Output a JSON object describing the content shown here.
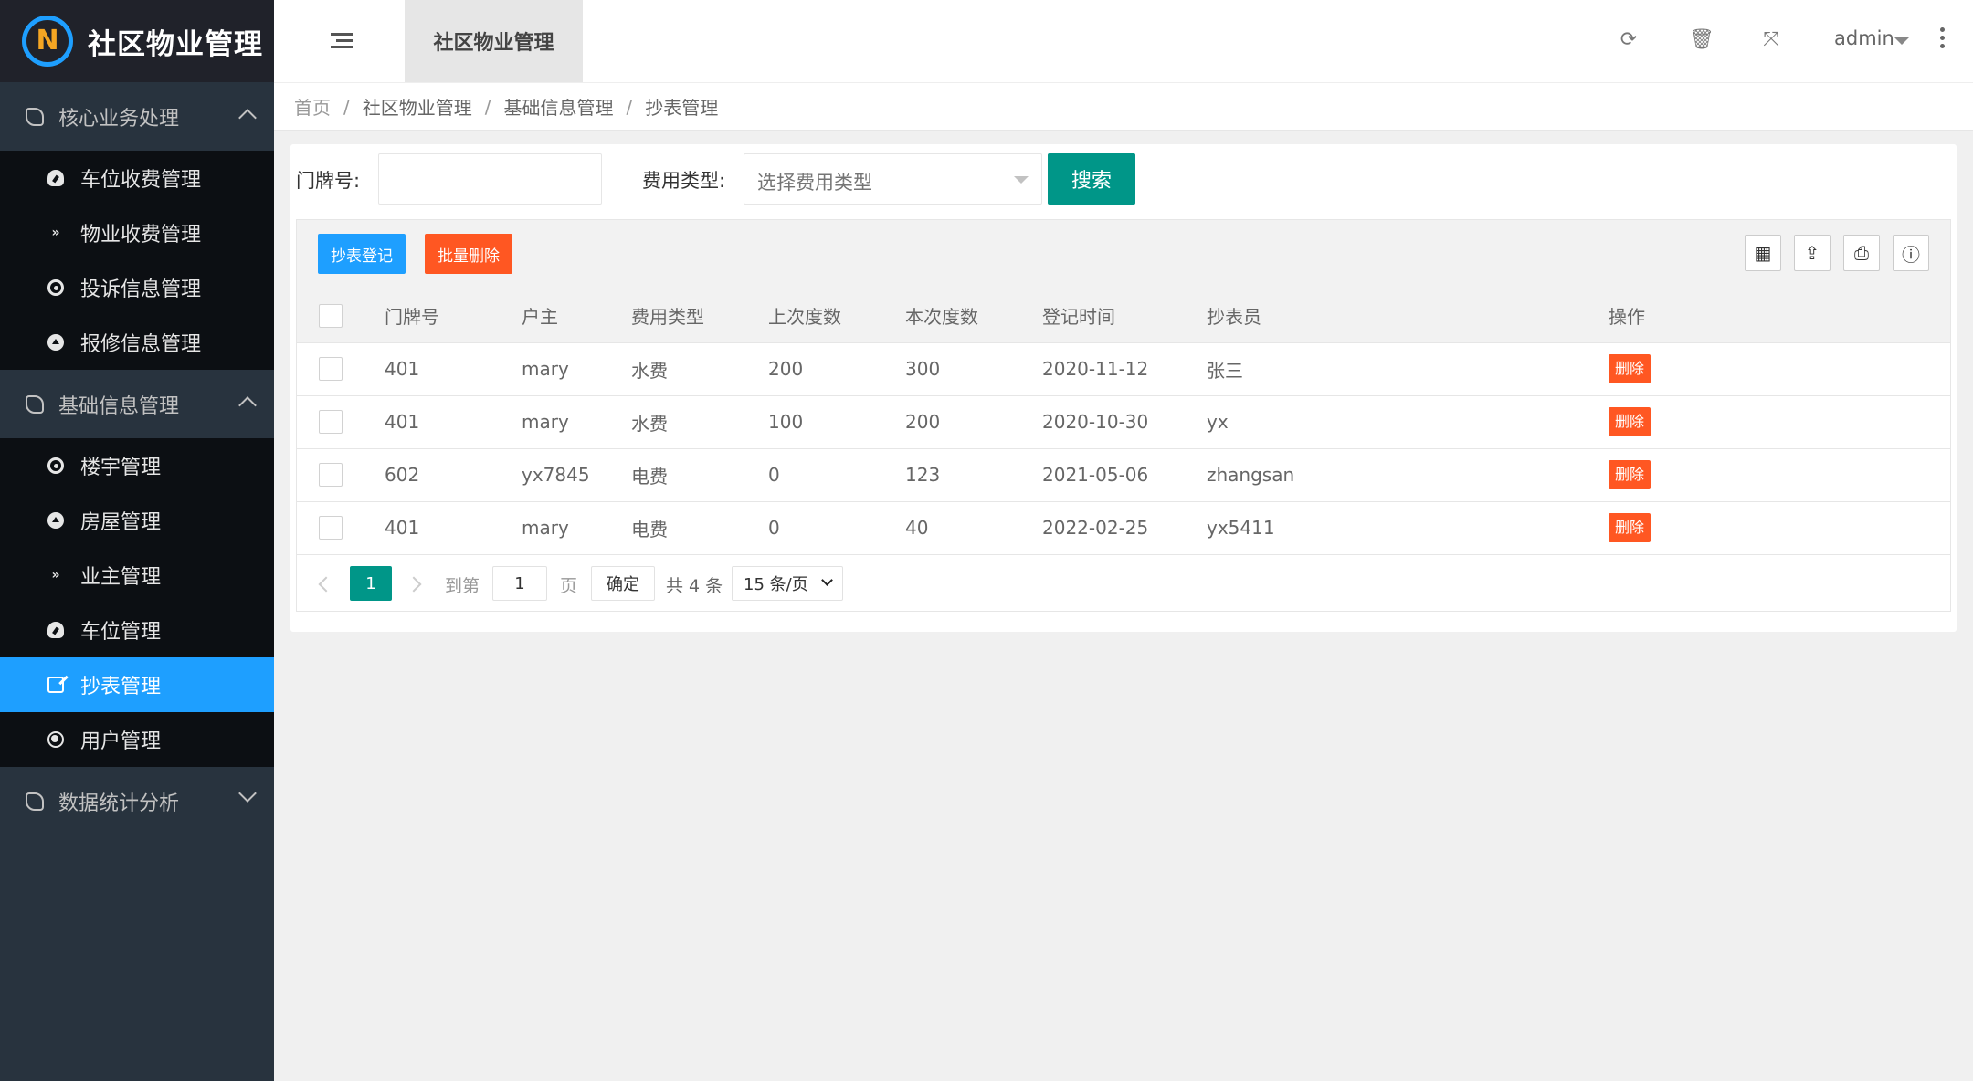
{
  "app": {
    "title": "社区物业管理",
    "logo_letters": "N"
  },
  "sidebar": {
    "groups": [
      {
        "label": "核心业务处理",
        "expanded": true,
        "items": [
          {
            "label": "车位收费管理",
            "icon": "gauge-icon"
          },
          {
            "label": "物业收费管理",
            "icon": "double-chevron-down-icon"
          },
          {
            "label": "投诉信息管理",
            "icon": "target-circle-icon"
          },
          {
            "label": "报修信息管理",
            "icon": "caret-circle-icon"
          }
        ]
      },
      {
        "label": "基础信息管理",
        "expanded": true,
        "items": [
          {
            "label": "楼宇管理",
            "icon": "target-circle-icon"
          },
          {
            "label": "房屋管理",
            "icon": "caret-circle-icon"
          },
          {
            "label": "业主管理",
            "icon": "double-chevron-down-icon"
          },
          {
            "label": "车位管理",
            "icon": "gauge-icon"
          },
          {
            "label": "抄表管理",
            "icon": "edit-icon",
            "active": true
          },
          {
            "label": "用户管理",
            "icon": "user-circle-icon"
          }
        ]
      },
      {
        "label": "数据统计分析",
        "expanded": false,
        "items": []
      }
    ]
  },
  "header": {
    "active_tab": "社区物业管理",
    "user": "admin"
  },
  "breadcrumb": [
    "首页",
    "社区物业管理",
    "基础信息管理",
    "抄表管理"
  ],
  "filters": {
    "door_label": "门牌号:",
    "door_value": "",
    "fee_label": "费用类型:",
    "fee_placeholder": "选择费用类型",
    "search_label": "搜索"
  },
  "toolbar": {
    "register_label": "抄表登记",
    "batch_delete_label": "批量删除",
    "tools": [
      "columns-icon",
      "export-icon",
      "print-icon",
      "info-icon"
    ]
  },
  "table": {
    "columns": [
      "门牌号",
      "户主",
      "费用类型",
      "上次度数",
      "本次度数",
      "登记时间",
      "抄表员",
      "操作"
    ],
    "rows": [
      {
        "door": "401",
        "owner": "mary",
        "fee_type": "水费",
        "last": "200",
        "current": "300",
        "date": "2020-11-12",
        "reader": "张三",
        "action": "删除"
      },
      {
        "door": "401",
        "owner": "mary",
        "fee_type": "水费",
        "last": "100",
        "current": "200",
        "date": "2020-10-30",
        "reader": "yx",
        "action": "删除"
      },
      {
        "door": "602",
        "owner": "yx7845",
        "fee_type": "电费",
        "last": "0",
        "current": "123",
        "date": "2021-05-06",
        "reader": "zhangsan",
        "action": "删除"
      },
      {
        "door": "401",
        "owner": "mary",
        "fee_type": "电费",
        "last": "0",
        "current": "40",
        "date": "2022-02-25",
        "reader": "yx5411",
        "action": "删除"
      }
    ]
  },
  "pagination": {
    "current_page": "1",
    "goto_label": "到第",
    "goto_value": "1",
    "page_unit": "页",
    "confirm_label": "确定",
    "total_label": "共 4 条",
    "page_size_label": "15 条/页"
  },
  "colors": {
    "sidebar_bg": "#28333e",
    "active_item": "#1e9fff",
    "primary": "#009688",
    "danger": "#ff5722"
  }
}
